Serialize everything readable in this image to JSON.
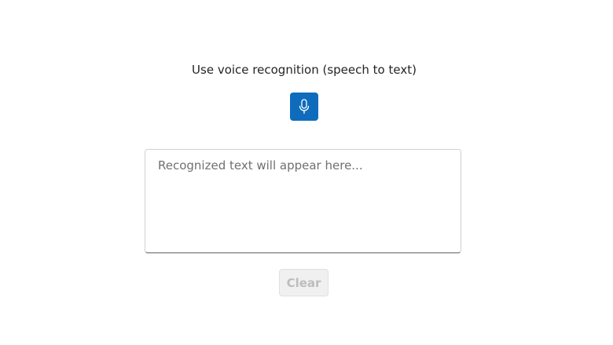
{
  "heading": "Use voice recognition (speech to text)",
  "mic_button": {
    "icon": "microphone-icon",
    "color": "#0f6cbd"
  },
  "transcript": {
    "value": "",
    "placeholder": "Recognized text will appear here..."
  },
  "clear_button": {
    "label": "Clear",
    "state": "disabled"
  }
}
